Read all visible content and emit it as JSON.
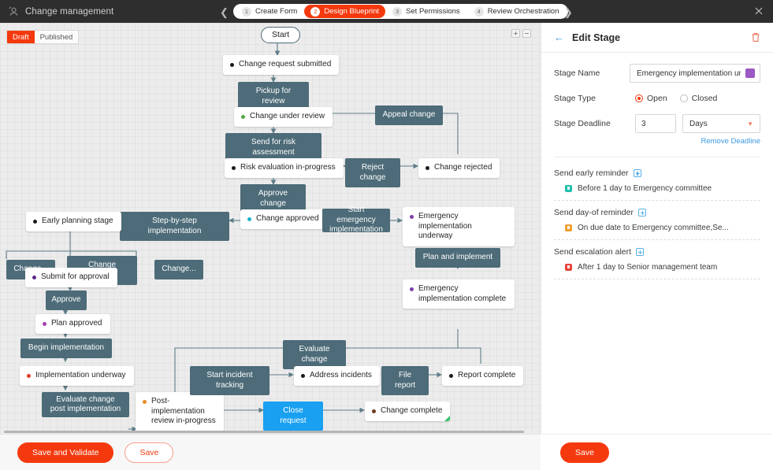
{
  "topbar": {
    "app_icon": "workflow-icon",
    "title": "Change management",
    "prev_icon": "chevron-left-icon",
    "next_icon": "chevron-right-icon",
    "close_icon": "close-icon",
    "steps": [
      {
        "num": "1",
        "label": "Create Form",
        "active": false
      },
      {
        "num": "2",
        "label": "Design Blueprint",
        "active": true
      },
      {
        "num": "3",
        "label": "Set Permissions",
        "active": false
      },
      {
        "num": "4",
        "label": "Review Orchestration",
        "active": false
      }
    ],
    "accent": "#f5390e"
  },
  "canvas": {
    "state_toggle": {
      "draft": "Draft",
      "published": "Published",
      "selected": "Draft"
    },
    "zoom_in": "zoom-in-icon",
    "zoom_out": "zoom-out-icon",
    "start_label": "Start",
    "states": [
      {
        "id": "s1",
        "label": "Change request submitted",
        "dot": "#1b1b1b"
      },
      {
        "id": "s2",
        "label": "Change under review",
        "dot": "#4fa83d"
      },
      {
        "id": "s3",
        "label": "Risk evaluation in-progress",
        "dot": "#1b1b1b"
      },
      {
        "id": "s4",
        "label": "Change rejected",
        "dot": "#1b1b1b"
      },
      {
        "id": "s5",
        "label": "Change approved",
        "dot": "#16b5c4"
      },
      {
        "id": "s6",
        "label": "Early planning stage",
        "dot": "#1b1b1b"
      },
      {
        "id": "s7",
        "label": "Emergency implementation underway",
        "dot": "#7a3fa8"
      },
      {
        "id": "s8",
        "label": "Submit for approval",
        "dot": "#5b2a86"
      },
      {
        "id": "s9",
        "label": "Plan approved",
        "dot": "#a23fb0"
      },
      {
        "id": "s10",
        "label": "Emergency implementation complete",
        "dot": "#7a3fa8"
      },
      {
        "id": "s11",
        "label": "Implementation underway",
        "dot": "#e03c2a"
      },
      {
        "id": "s12",
        "label": "Post-implementation review in-progress",
        "dot": "#e88b22"
      },
      {
        "id": "s13",
        "label": "Address incidents",
        "dot": "#1b1b1b"
      },
      {
        "id": "s14",
        "label": "Report complete",
        "dot": "#1b1b1b"
      },
      {
        "id": "s15",
        "label": "Change complete",
        "dot": "#6b3a1e"
      }
    ],
    "transitions": [
      {
        "id": "t1",
        "label": "Pickup for review"
      },
      {
        "id": "t2",
        "label": "Appeal change"
      },
      {
        "id": "t3",
        "label": "Send for risk assessment"
      },
      {
        "id": "t4",
        "label": "Reject change"
      },
      {
        "id": "t5",
        "label": "Approve change"
      },
      {
        "id": "t6",
        "label": "Step-by-step implementation"
      },
      {
        "id": "t7",
        "label": "Start emergency implementation"
      },
      {
        "id": "t8",
        "label": "Change..."
      },
      {
        "id": "t9",
        "label": "Change planning"
      },
      {
        "id": "t10",
        "label": "Change..."
      },
      {
        "id": "t11",
        "label": "Plan and implement"
      },
      {
        "id": "t12",
        "label": "Approve"
      },
      {
        "id": "t13",
        "label": "Begin implementation"
      },
      {
        "id": "t14",
        "label": "Evaluate change"
      },
      {
        "id": "t15",
        "label": "Start incident tracking"
      },
      {
        "id": "t16",
        "label": "File report"
      },
      {
        "id": "t17",
        "label": "Evaluate change post implementation"
      },
      {
        "id": "t18",
        "label": "Close request"
      }
    ]
  },
  "panel": {
    "back_icon": "back-arrow-icon",
    "title": "Edit Stage",
    "delete_icon": "trash-icon",
    "stage_name_label": "Stage Name",
    "stage_name_value": "Emergency implementation und",
    "stage_color": "#9b59c4",
    "stage_type_label": "Stage Type",
    "stage_type_options": [
      "Open",
      "Closed"
    ],
    "stage_type_selected": "Open",
    "stage_deadline_label": "Stage Deadline",
    "deadline_value": "3",
    "deadline_unit": "Days",
    "deadline_unit_caret": "chevron-down-icon",
    "remove_deadline": "Remove Deadline",
    "alerts": [
      {
        "title": "Send early reminder",
        "add_icon": "add-icon",
        "item": "Before 1 day to Emergency committee",
        "item_icon_color": "#1fbfae"
      },
      {
        "title": "Send day-of reminder",
        "add_icon": "add-icon",
        "item": "On due date to Emergency committee,Se...",
        "item_icon_color": "#f0a030"
      },
      {
        "title": "Send escalation alert",
        "add_icon": "add-icon",
        "item": "After 1 day to Senior management team",
        "item_icon_color": "#e8443a"
      }
    ],
    "save_label": "Save"
  },
  "footer": {
    "save_validate_label": "Save and Validate",
    "save_label": "Save"
  }
}
